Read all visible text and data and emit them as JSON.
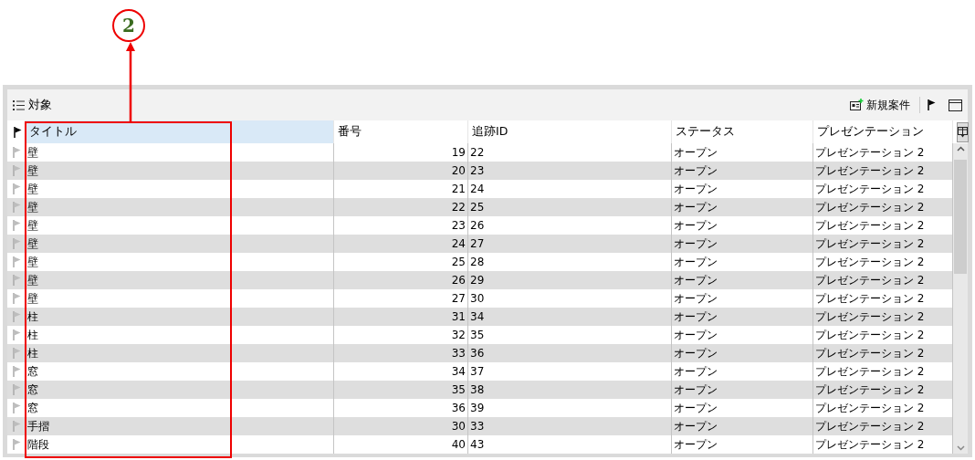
{
  "annotation": {
    "label": "2"
  },
  "toolbar": {
    "title": "対象",
    "new_button": "新規案件"
  },
  "table": {
    "columns": [
      {
        "label": "タイトル",
        "sorted": true
      },
      {
        "label": "番号",
        "sorted": false
      },
      {
        "label": "追跡ID",
        "sorted": false
      },
      {
        "label": "ステータス",
        "sorted": false
      },
      {
        "label": "プレゼンテーション",
        "sorted": false
      }
    ],
    "rows": [
      {
        "title": "壁",
        "number": "19",
        "tracking_id": "22",
        "status": "オープン",
        "presentation": "プレゼンテーション 2"
      },
      {
        "title": "壁",
        "number": "20",
        "tracking_id": "23",
        "status": "オープン",
        "presentation": "プレゼンテーション 2"
      },
      {
        "title": "壁",
        "number": "21",
        "tracking_id": "24",
        "status": "オープン",
        "presentation": "プレゼンテーション 2"
      },
      {
        "title": "壁",
        "number": "22",
        "tracking_id": "25",
        "status": "オープン",
        "presentation": "プレゼンテーション 2"
      },
      {
        "title": "壁",
        "number": "23",
        "tracking_id": "26",
        "status": "オープン",
        "presentation": "プレゼンテーション 2"
      },
      {
        "title": "壁",
        "number": "24",
        "tracking_id": "27",
        "status": "オープン",
        "presentation": "プレゼンテーション 2"
      },
      {
        "title": "壁",
        "number": "25",
        "tracking_id": "28",
        "status": "オープン",
        "presentation": "プレゼンテーション 2"
      },
      {
        "title": "壁",
        "number": "26",
        "tracking_id": "29",
        "status": "オープン",
        "presentation": "プレゼンテーション 2"
      },
      {
        "title": "壁",
        "number": "27",
        "tracking_id": "30",
        "status": "オープン",
        "presentation": "プレゼンテーション 2"
      },
      {
        "title": "柱",
        "number": "31",
        "tracking_id": "34",
        "status": "オープン",
        "presentation": "プレゼンテーション 2"
      },
      {
        "title": "柱",
        "number": "32",
        "tracking_id": "35",
        "status": "オープン",
        "presentation": "プレゼンテーション 2"
      },
      {
        "title": "柱",
        "number": "33",
        "tracking_id": "36",
        "status": "オープン",
        "presentation": "プレゼンテーション 2"
      },
      {
        "title": "窓",
        "number": "34",
        "tracking_id": "37",
        "status": "オープン",
        "presentation": "プレゼンテーション 2"
      },
      {
        "title": "窓",
        "number": "35",
        "tracking_id": "38",
        "status": "オープン",
        "presentation": "プレゼンテーション 2"
      },
      {
        "title": "窓",
        "number": "36",
        "tracking_id": "39",
        "status": "オープン",
        "presentation": "プレゼンテーション 2"
      },
      {
        "title": "手摺",
        "number": "30",
        "tracking_id": "33",
        "status": "オープン",
        "presentation": "プレゼンテーション 2"
      },
      {
        "title": "階段",
        "number": "40",
        "tracking_id": "43",
        "status": "オープン",
        "presentation": "プレゼンテーション 2"
      }
    ]
  }
}
